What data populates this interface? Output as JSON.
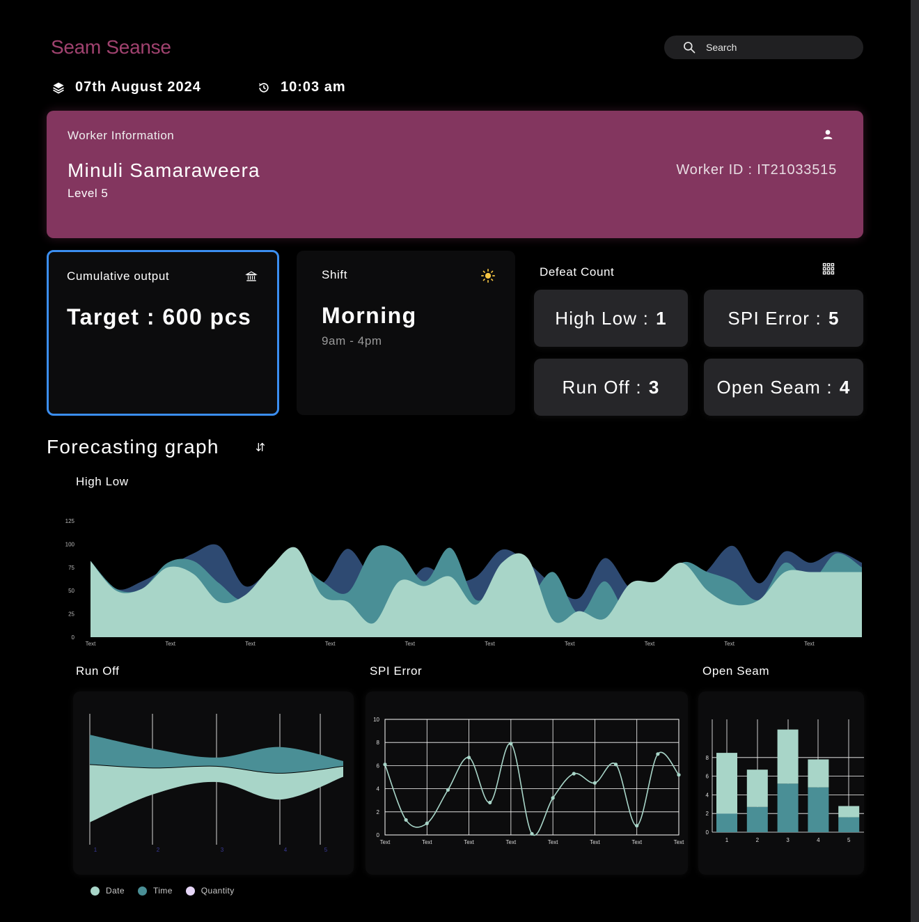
{
  "header": {
    "brand": "Seam Seanse",
    "search_placeholder": "Search",
    "date": "07th August 2024",
    "time": "10:03 am"
  },
  "worker": {
    "label": "Worker Information",
    "name": "Minuli Samaraweera",
    "level": "Level 5",
    "worker_id": "Worker ID : IT21033515"
  },
  "cumulative": {
    "label": "Cumulative output",
    "target": "Target : 600 pcs"
  },
  "shift": {
    "label": "Shift",
    "name": "Morning",
    "hours": "9am - 4pm"
  },
  "defect": {
    "title": "Defeat Count",
    "items": [
      {
        "label": "High Low :",
        "value": "1"
      },
      {
        "label": "SPI Error :",
        "value": "5"
      },
      {
        "label": "Run Off :",
        "value": "3"
      },
      {
        "label": "Open Seam :",
        "value": "4"
      }
    ]
  },
  "forecast": {
    "title": "Forecasting graph",
    "section_labels": {
      "high_low": "High Low",
      "run_off": "Run Off",
      "spi_error": "SPI Error",
      "open_seam": "Open Seam"
    }
  },
  "legend": [
    {
      "label": "Date",
      "color": "#a8d5c8"
    },
    {
      "label": "Time",
      "color": "#4a8f96"
    },
    {
      "label": "Quantity",
      "color": "#e6d6f7"
    }
  ],
  "colors": {
    "brand": "#a0426f",
    "worker_card": "#83365f",
    "highlight_border": "#3b8ef0",
    "series_light": "#a8d5c8",
    "series_mid": "#4a8f96",
    "series_dark": "#2e4a72"
  },
  "chart_data": [
    {
      "type": "area",
      "x_tick_labels": [
        "Text",
        "Text",
        "Text",
        "Text",
        "Text",
        "Text",
        "Text",
        "Text",
        "Text",
        "Text"
      ],
      "y_ticks": [
        0,
        25,
        50,
        75,
        100,
        125
      ],
      "ylim": [
        0,
        125
      ],
      "series": [
        {
          "color": "#2e4a72",
          "values": [
            82,
            52,
            60,
            75,
            90,
            98,
            55,
            72,
            80,
            58,
            95,
            60,
            45,
            75,
            60,
            65,
            94,
            80,
            56,
            42,
            85,
            52,
            46,
            42,
            72,
            98,
            58,
            92,
            80,
            92,
            80
          ]
        },
        {
          "color": "#4a8f96",
          "values": [
            82,
            52,
            52,
            80,
            82,
            58,
            40,
            75,
            80,
            60,
            48,
            95,
            92,
            60,
            96,
            40,
            62,
            42,
            70,
            25,
            60,
            20,
            45,
            80,
            70,
            60,
            40,
            80,
            60,
            90,
            75
          ]
        },
        {
          "color": "#a8d5c8",
          "values": [
            82,
            50,
            52,
            75,
            68,
            38,
            45,
            75,
            96,
            45,
            38,
            15,
            60,
            55,
            65,
            35,
            80,
            85,
            18,
            28,
            20,
            58,
            60,
            80,
            50,
            35,
            40,
            70,
            70,
            70,
            70
          ]
        }
      ]
    },
    {
      "type": "area",
      "x_tick_labels": [
        "1",
        "2",
        "3",
        "4",
        "5"
      ],
      "series": [
        {
          "color": "#4a8f96",
          "upper": [
            62,
            54,
            49,
            55,
            47
          ],
          "lower": [
            45,
            43,
            44,
            40,
            44
          ]
        },
        {
          "color": "#a8d5c8",
          "upper": [
            45,
            43,
            44,
            40,
            44
          ],
          "lower": [
            12,
            28,
            35,
            25,
            38
          ]
        }
      ]
    },
    {
      "type": "line",
      "x_tick_labels": [
        "Text",
        "Text",
        "Text",
        "Text",
        "Text",
        "Text",
        "Text",
        "Text"
      ],
      "y_ticks": [
        0,
        2,
        4,
        6,
        8,
        10
      ],
      "ylim": [
        0,
        10
      ],
      "values": [
        6.1,
        1.3,
        1.0,
        3.9,
        6.7,
        2.8,
        7.9,
        0.1,
        3.2,
        5.3,
        4.5,
        6.1,
        0.8,
        7.0,
        5.2
      ]
    },
    {
      "type": "bar",
      "categories": [
        "1",
        "2",
        "3",
        "4",
        "5"
      ],
      "y_ticks": [
        0,
        2,
        4,
        6,
        8
      ],
      "series": [
        {
          "color": "#4a8f96",
          "values": [
            2.0,
            2.7,
            5.2,
            4.8,
            1.6
          ]
        },
        {
          "color": "#a8d5c8",
          "values": [
            6.5,
            4.0,
            5.8,
            3.0,
            1.2
          ]
        }
      ]
    }
  ]
}
